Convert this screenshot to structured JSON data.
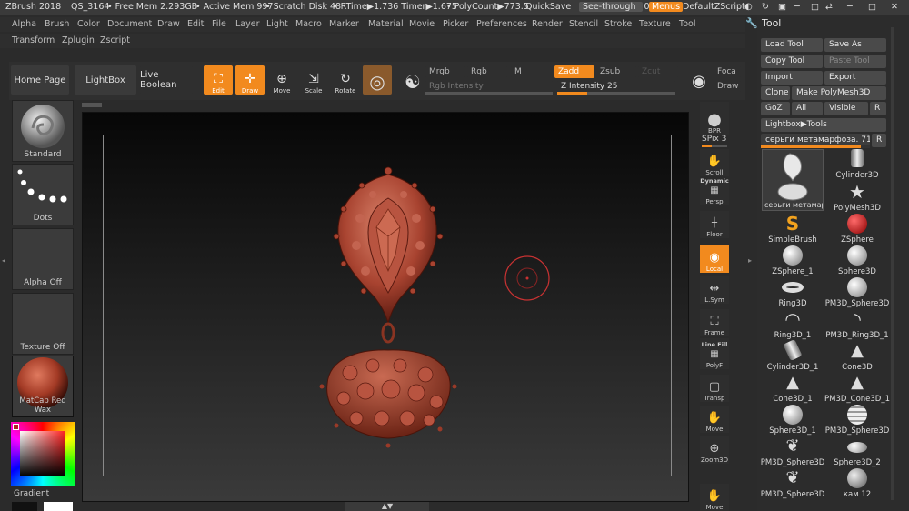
{
  "titlebar": {
    "app": "ZBrush 2018",
    "qs": "QS_3164",
    "free_mem": "• Free Mem 2.293GB",
    "active_mem": "• Active Mem 997",
    "scratch": "• Scratch Disk 48",
    "rtime": "• RTime▶1.736 Timer▶1.675",
    "polycount": "• PolyCount▶773.5",
    "quicksave": "QuickSave",
    "seethrough": "See-through",
    "seethrough_val": "0",
    "menus": "Menus",
    "zscript": "DefaultZScript"
  },
  "menu1": [
    "Alpha",
    "Brush",
    "Color",
    "Document",
    "Draw",
    "Edit",
    "File",
    "Layer",
    "Light",
    "Macro",
    "Marker",
    "Material",
    "Movie",
    "Picker",
    "Preferences",
    "Render",
    "Stencil",
    "Stroke",
    "Texture",
    "Tool"
  ],
  "menu2": [
    "Transform",
    "Zplugin",
    "Zscript"
  ],
  "shelf": {
    "home": "Home Page",
    "lightbox": "LightBox",
    "live_boolean": "Live Boolean",
    "edit": "Edit",
    "draw": "Draw",
    "move": "Move",
    "scale": "Scale",
    "rotate": "Rotate",
    "mrgb": "Mrgb",
    "rgb": "Rgb",
    "m": "M",
    "zadd": "Zadd",
    "zsub": "Zsub",
    "zcut": "Zcut",
    "rgb_intensity": "Rgb Intensity",
    "z_intensity": "Z Intensity 25",
    "focal": "Foca",
    "draw2": "Draw"
  },
  "left": {
    "standard": "Standard",
    "dots": "Dots",
    "alpha_off": "Alpha Off",
    "texture_off": "Texture Off",
    "matcap": "MatCap Red Wax",
    "gradient": "Gradient"
  },
  "rightshelf": {
    "bpr": "BPR",
    "spix": "SPix 3",
    "scroll": "Scroll",
    "dynamic": "Dynamic",
    "persp": "Persp",
    "floor": "Floor",
    "local": "Local",
    "lsym": "L.Sym",
    "frame": "Frame",
    "linefill": "Line Fill",
    "polyf": "PolyF",
    "transp": "Transp",
    "move": "Move",
    "zoom3d": "Zoom3D",
    "move2": "Move"
  },
  "palette": {
    "title": "Tool",
    "load_tool": "Load Tool",
    "save_as": "Save As",
    "copy_tool": "Copy Tool",
    "paste_tool": "Paste Tool",
    "import": "Import",
    "export": "Export",
    "clone": "Clone",
    "make_polymesh": "Make PolyMesh3D",
    "goz": "GoZ",
    "all": "All",
    "visible": "Visible",
    "r": "R",
    "lightbox_tools": "Lightbox▶Tools",
    "current_tool": "серьги метамарфоза. 71",
    "current_tool_short": "серьги метамар",
    "tiles": [
      "Cylinder3D",
      "PolyMesh3D",
      "SimpleBrush",
      "ZSphere",
      "ZSphere_1",
      "Sphere3D",
      "Ring3D",
      "PM3D_Sphere3D",
      "Ring3D_1",
      "PM3D_Ring3D_1",
      "Cylinder3D_1",
      "Cone3D",
      "Cone3D_1",
      "PM3D_Cone3D_1",
      "Sphere3D_1",
      "PM3D_Sphere3D",
      "PM3D_Sphere3D",
      "Sphere3D_2",
      "PM3D_Sphere3D",
      "кам 12"
    ]
  },
  "colors": {
    "accent": "#f28a1e",
    "model": "#b34a36",
    "brush_circle": "#c83232"
  }
}
